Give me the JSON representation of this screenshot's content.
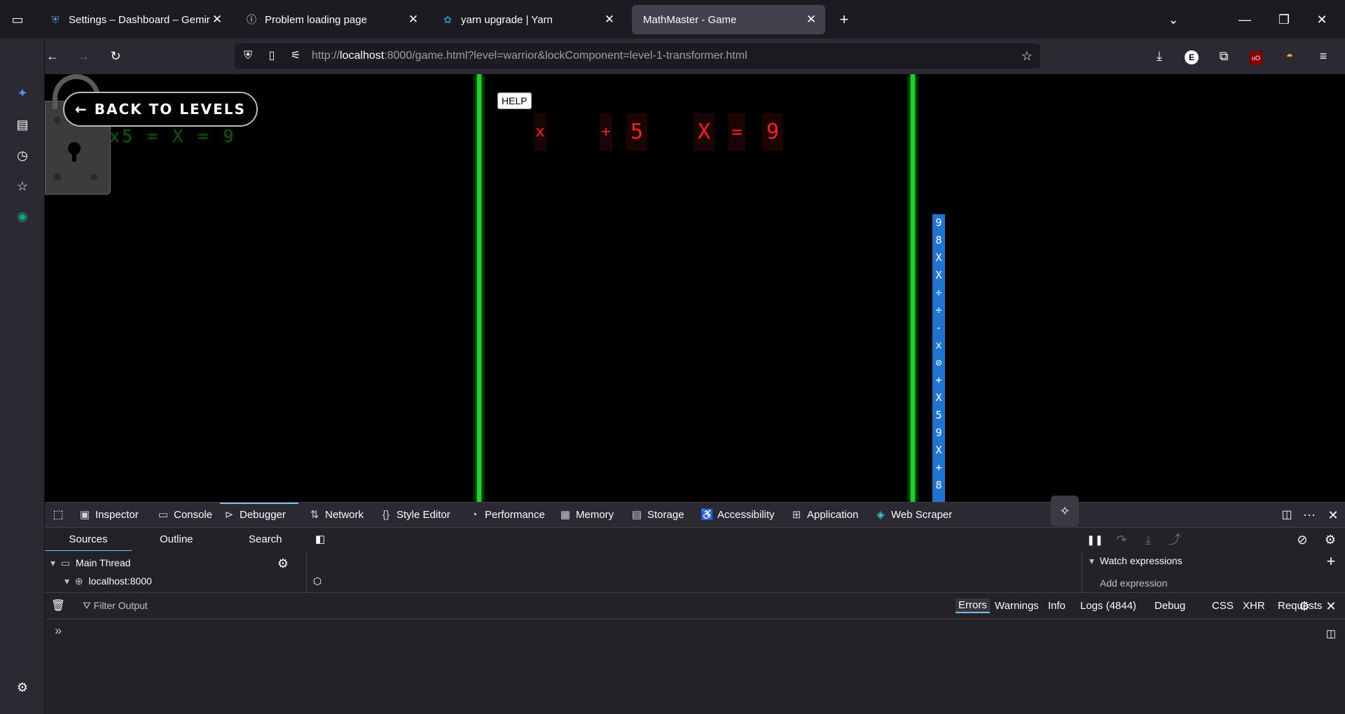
{
  "browser": {
    "tabs": [
      {
        "label": "Settings – Dashboard – Gemini",
        "icon": "shield-icon",
        "active": false
      },
      {
        "label": "Problem loading page",
        "icon": "info-icon",
        "active": false
      },
      {
        "label": "yarn upgrade | Yarn",
        "icon": "yarn-icon",
        "active": false
      },
      {
        "label": "MathMaster - Game",
        "icon": "",
        "active": true
      }
    ],
    "url_host": "localhost",
    "url_rest": ":8000/game.html?level=warrior&lockComponent=level-1-transformer.html",
    "url_prefix": "http://"
  },
  "game": {
    "back_label": "← BACK TO LEVELS",
    "ghost_equation": "x5 = X = 9",
    "help_label": "HELP",
    "equation_chars": [
      "x",
      "+",
      "5",
      "X",
      "=",
      "9"
    ],
    "strip_chars": [
      "9",
      "8",
      "X",
      "X",
      "÷",
      "÷",
      "-",
      "x",
      "⊘",
      "+",
      "X",
      "5",
      "9",
      "X",
      "+",
      "8"
    ],
    "colors": {
      "pole": "#1fd12b",
      "equation": "#ff1d1d",
      "strip": "#1e74d0"
    }
  },
  "devtools": {
    "tabs": [
      {
        "label": "Inspector",
        "icon": "inspector-icon"
      },
      {
        "label": "Console",
        "icon": "console-icon"
      },
      {
        "label": "Debugger",
        "icon": "debugger-icon",
        "active": true
      },
      {
        "label": "Network",
        "icon": "network-icon"
      },
      {
        "label": "Style Editor",
        "icon": "braces-icon"
      },
      {
        "label": "Performance",
        "icon": "gauge-icon"
      },
      {
        "label": "Memory",
        "icon": "chip-icon"
      },
      {
        "label": "Storage",
        "icon": "storage-icon"
      },
      {
        "label": "Accessibility",
        "icon": "accessibility-icon"
      },
      {
        "label": "Application",
        "icon": "grid-icon"
      },
      {
        "label": "Web Scraper",
        "icon": "globe-icon"
      }
    ],
    "debugger": {
      "subtabs": [
        "Sources",
        "Outline",
        "Search"
      ],
      "thread": "Main Thread",
      "host": "localhost:8000",
      "watch_title": "Watch expressions",
      "watch_placeholder": "Add expression"
    },
    "console": {
      "filter_placeholder": "Filter Output",
      "filters": [
        "Errors",
        "Warnings",
        "Info",
        "Logs (4844)",
        "Debug",
        "CSS",
        "XHR",
        "Requests"
      ],
      "prompt": "»"
    }
  }
}
